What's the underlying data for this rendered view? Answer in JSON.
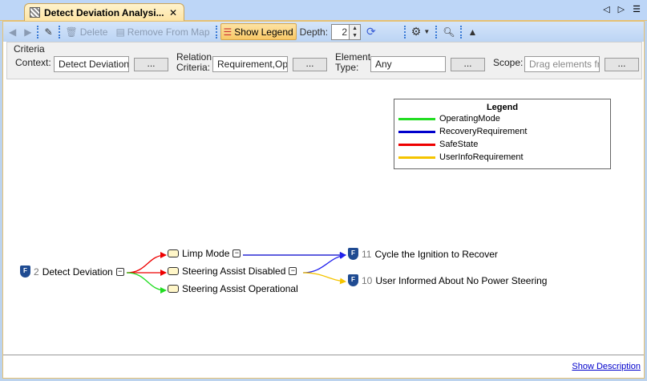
{
  "tab": {
    "title": "Detect Deviation Analysi...",
    "close": "✕"
  },
  "nav": {
    "prev": "◁",
    "next": "▷",
    "menu": "☰"
  },
  "toolbar": {
    "delete": "Delete",
    "remove": "Remove From Map",
    "show_legend": "Show Legend",
    "depth_label": "Depth:",
    "depth_value": "2"
  },
  "criteria": {
    "title": "Criteria",
    "context_label": "Context:",
    "context_value": "Detect Deviation",
    "relation_label_1": "Relation",
    "relation_label_2": "Criteria:",
    "relation_value": "Requirement,Oper",
    "element_label_1": "Element",
    "element_label_2": "Type:",
    "element_value": "Any",
    "scope_label": "Scope:",
    "scope_placeholder": "Drag elements fro",
    "dots": "..."
  },
  "legend": {
    "title": "Legend",
    "items": [
      {
        "label": "OperatingMode",
        "color": "#22dd22"
      },
      {
        "label": "RecoveryRequirement",
        "color": "#0000cc"
      },
      {
        "label": "SafeState",
        "color": "#ee0000"
      },
      {
        "label": "UserInfoRequirement",
        "color": "#f5c400"
      }
    ]
  },
  "nodes": {
    "root": {
      "num": "2",
      "label": "Detect Deviation"
    },
    "limp": {
      "label": "Limp Mode"
    },
    "disabled": {
      "label": "Steering Assist Disabled"
    },
    "operational": {
      "label": "Steering Assist Operational"
    },
    "cycle": {
      "num": "11",
      "label": "Cycle the Ignition to Recover"
    },
    "informed": {
      "num": "10",
      "label": "User Informed About No Power Steering"
    }
  },
  "footer": {
    "show_description": "Show Description"
  }
}
